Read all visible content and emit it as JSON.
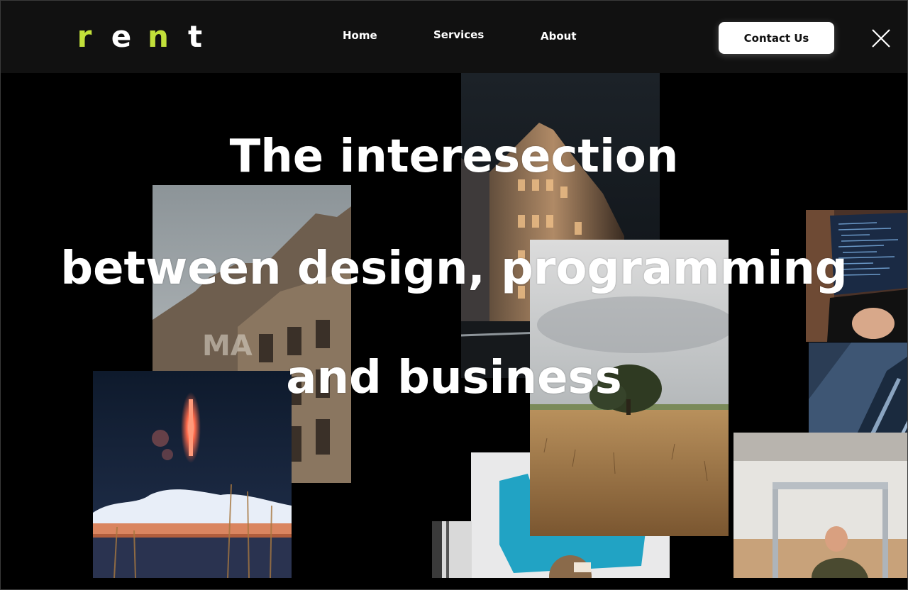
{
  "brand": {
    "letters": [
      "r",
      "e",
      "n",
      "t"
    ],
    "accent_color": "#c2e03a"
  },
  "nav": {
    "home": "Home",
    "services": "Services",
    "about": "About"
  },
  "header": {
    "contact_label": "Contact Us",
    "close_icon": "close-icon"
  },
  "hero": {
    "line1": "The interesection",
    "line2": "between design, programming",
    "line3": "and business"
  },
  "photos": [
    {
      "name": "photo-old-building-graffiti",
      "subject": "old building with graffiti"
    },
    {
      "name": "photo-city-building-night",
      "subject": "illuminated city building at night"
    },
    {
      "name": "photo-laptop-code",
      "subject": "hands typing code on laptop"
    },
    {
      "name": "photo-rocket-launch",
      "subject": "rocket launch at night"
    },
    {
      "name": "photo-tree-field",
      "subject": "lone tree in dry grass field"
    },
    {
      "name": "photo-architecture-blue",
      "subject": "blue modern architecture"
    },
    {
      "name": "photo-workshop-person",
      "subject": "person working in workshop"
    },
    {
      "name": "photo-blue-paint",
      "subject": "blue paint on white paper"
    },
    {
      "name": "photo-small-strip",
      "subject": "partial photo"
    }
  ],
  "colors": {
    "background": "#000000",
    "header_background": "#111111",
    "text": "#ffffff"
  }
}
